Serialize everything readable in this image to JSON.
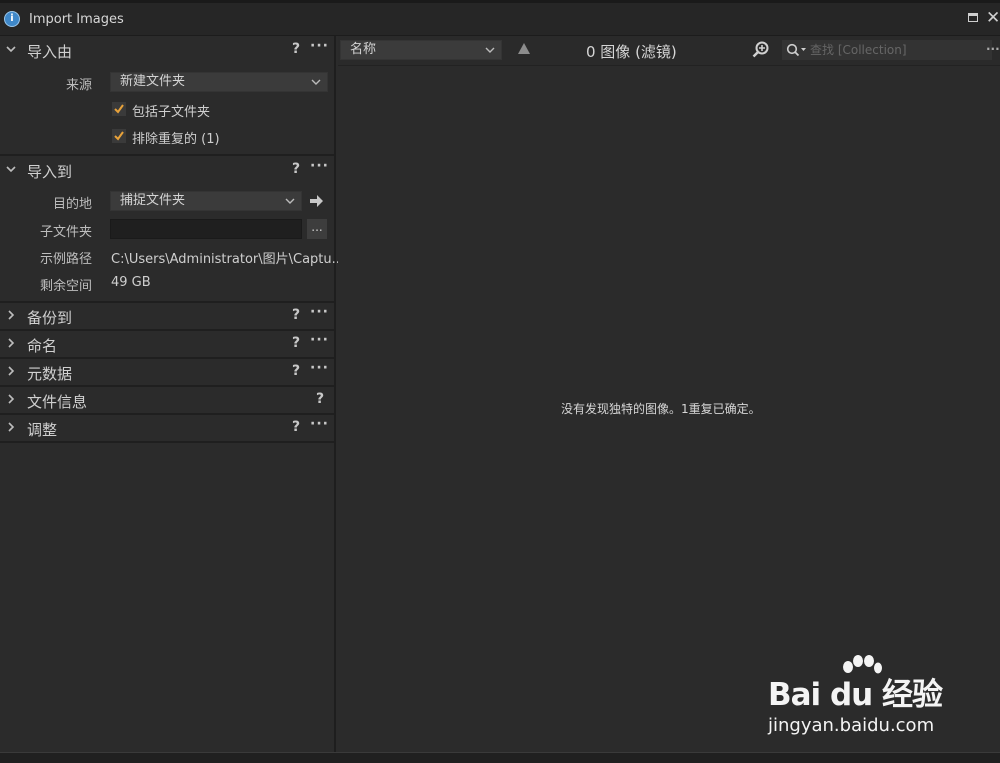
{
  "window": {
    "title": "Import Images"
  },
  "sections": {
    "import_from": {
      "title": "导入由",
      "help": "?",
      "more": "···",
      "source_label": "来源",
      "source_value": "新建文件夹",
      "include_subfolders": "包括子文件夹",
      "exclude_duplicates": "排除重复的 (1)"
    },
    "import_to": {
      "title": "导入到",
      "help": "?",
      "more": "···",
      "destination_label": "目的地",
      "destination_value": "捕捉文件夹",
      "subfolder_label": "子文件夹",
      "subfolder_value": "",
      "browse_label": "...",
      "example_path_label": "示例路径",
      "example_path_value": "C:\\Users\\Administrator\\图片\\Captu...",
      "free_space_label": "剩余空间",
      "free_space_value": "49 GB"
    },
    "backup_to": {
      "title": "备份到",
      "help": "?",
      "more": "···"
    },
    "naming": {
      "title": "命名",
      "help": "?",
      "more": "···"
    },
    "metadata": {
      "title": "元数据",
      "help": "?",
      "more": "···"
    },
    "file_info": {
      "title": "文件信息",
      "help": "?"
    },
    "adjustments": {
      "title": "调整",
      "help": "?",
      "more": "···"
    }
  },
  "toolbar": {
    "sort_value": "名称",
    "image_count": "0 图像 (滤镜)",
    "search_placeholder": "查找 [Collection]",
    "more": "···"
  },
  "main": {
    "empty_message": "没有发现独特的图像。1重复已确定。"
  },
  "watermark": {
    "brand": "Bai du 经验",
    "url": "jingyan.baidu.com"
  },
  "colors": {
    "accent_check": "#e8a23a",
    "background": "#2b2b2b",
    "field": "#3b3b3b"
  }
}
